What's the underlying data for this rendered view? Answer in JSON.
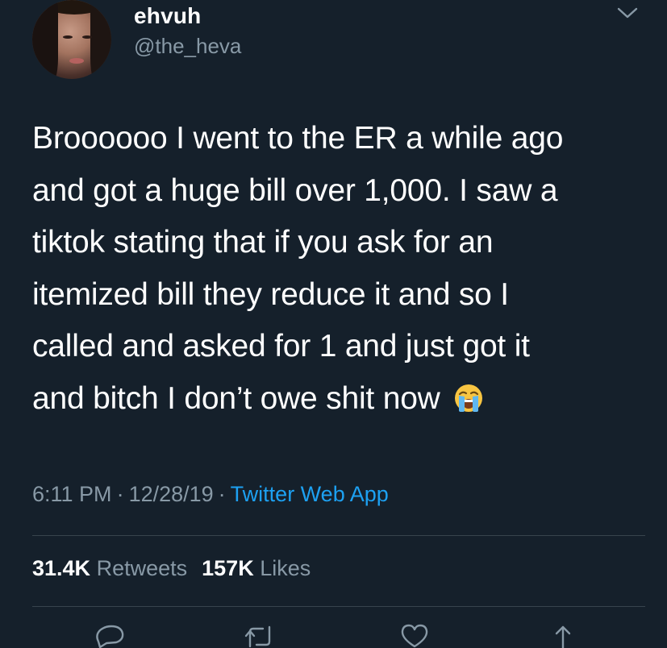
{
  "author": {
    "display_name": "ehvuh",
    "handle": "@the_heva",
    "avatar_icon": "profile-photo"
  },
  "tweet": {
    "lines": [
      "Broooooo I went to the ER a while ago",
      "and got a huge bill over 1,000. I saw a",
      "tiktok stating that if you ask for an",
      "itemized bill they reduce it and so I",
      "called and asked for 1 and just got it",
      "and bitch I don’t owe shit now"
    ],
    "emoji": "loudly-crying-face-emoji"
  },
  "meta": {
    "time": "6:11 PM",
    "separator": "·",
    "date": "12/28/19",
    "source": "Twitter Web App"
  },
  "stats": {
    "retweets_count": "31.4K",
    "retweets_label": "Retweets",
    "likes_count": "157K",
    "likes_label": "Likes"
  },
  "actions": {
    "reply_icon": "reply-icon",
    "retweet_icon": "retweet-icon",
    "like_icon": "heart-icon",
    "share_icon": "share-icon",
    "more_icon": "chevron-down-icon"
  },
  "colors": {
    "background": "#15202b",
    "text": "#ffffff",
    "secondary": "#8899a6",
    "link": "#1da1f2",
    "divider": "#38444d"
  }
}
